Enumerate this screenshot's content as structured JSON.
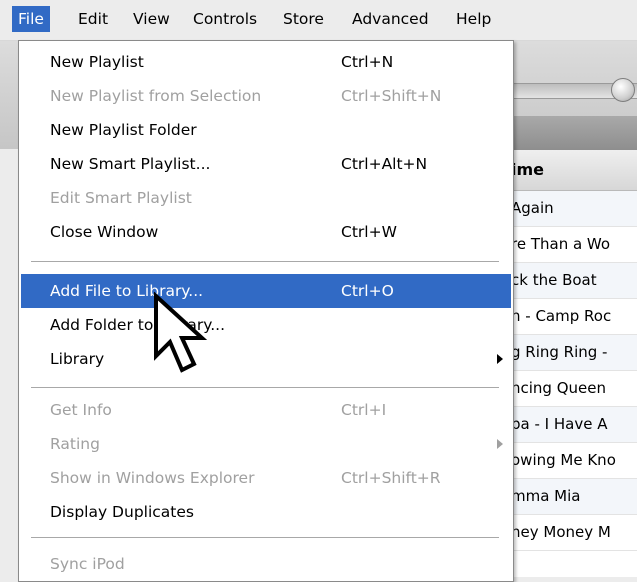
{
  "menubar": {
    "items": [
      {
        "label": "File"
      },
      {
        "label": "Edit"
      },
      {
        "label": "View"
      },
      {
        "label": "Controls"
      },
      {
        "label": "Store"
      },
      {
        "label": "Advanced"
      },
      {
        "label": "Help"
      }
    ]
  },
  "file_menu": {
    "group1": [
      {
        "label": "New Playlist",
        "accel": "Ctrl+N"
      },
      {
        "label": "New Playlist from Selection",
        "accel": "Ctrl+Shift+N"
      },
      {
        "label": "New Playlist Folder",
        "accel": ""
      },
      {
        "label": "New Smart Playlist...",
        "accel": "Ctrl+Alt+N"
      },
      {
        "label": "Edit Smart Playlist",
        "accel": ""
      },
      {
        "label": "Close Window",
        "accel": "Ctrl+W"
      }
    ],
    "group2": [
      {
        "label": "Add File to Library...",
        "accel": "Ctrl+O"
      },
      {
        "label": "Add Folder to Library...",
        "accel": ""
      },
      {
        "label": "Library",
        "accel": ""
      }
    ],
    "group3": [
      {
        "label": "Get Info",
        "accel": "Ctrl+I"
      },
      {
        "label": "Rating",
        "accel": ""
      },
      {
        "label": "Show in Windows Explorer",
        "accel": "Ctrl+Shift+R"
      },
      {
        "label": "Display Duplicates",
        "accel": ""
      }
    ],
    "group4": [
      {
        "label": "Sync iPod",
        "accel": ""
      }
    ]
  },
  "song_list": {
    "header": "ime",
    "rows": [
      " Again",
      "re Than a Wo",
      "ck the Boat",
      "n - Camp Roc",
      "g Ring Ring -",
      "ncing Queen",
      "ba - I Have A",
      "owing Me Kno",
      "mma Mia",
      "ney Money M"
    ]
  },
  "colors": {
    "selection": "#316ac5",
    "disabled_text": "#a0a0a0"
  },
  "icons": [
    "submenu-arrow-icon",
    "mouse-pointer-icon",
    "volume-slider-knob"
  ]
}
